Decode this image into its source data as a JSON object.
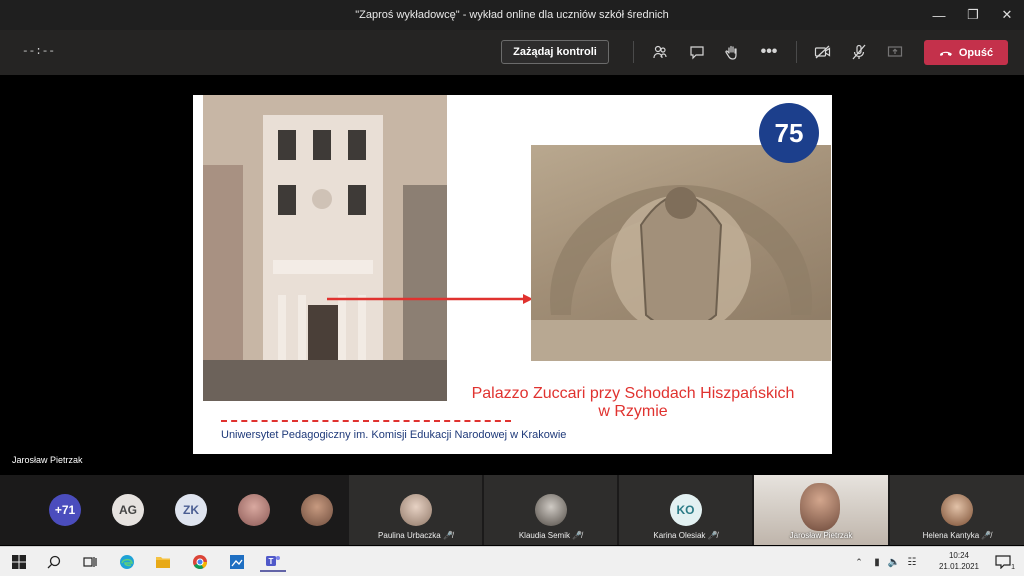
{
  "window": {
    "title": "\"Zaproś wykładowcę\" - wykład online dla uczniów szkół średnich"
  },
  "toolbar": {
    "timer": "--:--",
    "request_control_label": "Zażądaj kontroli",
    "leave_label": "Opuść",
    "icons": [
      "participants-icon",
      "chat-icon",
      "raise-hand-icon",
      "more-icon",
      "camera-off-icon",
      "mic-off-icon",
      "share-icon"
    ]
  },
  "slide": {
    "caption": "Palazzo Zuccari przy Schodach Hiszpańskich\nw Rzymie",
    "footer": "Uniwersytet Pedagogiczny im. Komisji Edukacji Narodowej w Krakowie",
    "logo_text": "75"
  },
  "stage": {
    "presenter_name": "Jarosław Pietrzak"
  },
  "roster": {
    "overflow_count": "+71",
    "avatars": [
      {
        "initials": "AG"
      },
      {
        "initials": "ZK"
      }
    ],
    "tiles": [
      {
        "name": "Paulina Urbaczka"
      },
      {
        "name": "Klaudia Semik"
      },
      {
        "name": "Karina Olesiak",
        "initials": "KO"
      },
      {
        "name": "Jarosław Pietrzak"
      },
      {
        "name": "Helena Kantyka"
      }
    ]
  },
  "taskbar": {
    "time": "10:24",
    "date": "21.01.2021",
    "notification_count": "1"
  },
  "colors": {
    "leave": "#c4314b",
    "accent": "#6264a7",
    "caption_red": "#e0322f"
  }
}
